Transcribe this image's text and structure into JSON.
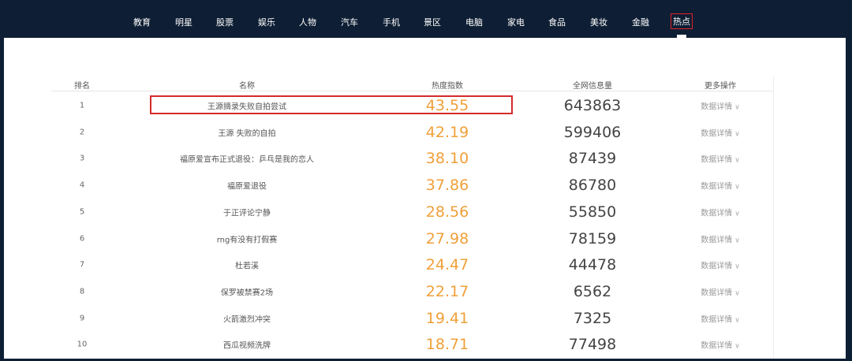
{
  "nav": {
    "items": [
      "教育",
      "明星",
      "股票",
      "娱乐",
      "人物",
      "汽车",
      "手机",
      "景区",
      "电脑",
      "家电",
      "食品",
      "美妆",
      "金融",
      "热点"
    ],
    "active_index": 13
  },
  "table": {
    "headers": {
      "rank": "排名",
      "name": "名称",
      "heat": "热度指数",
      "info": "全网信息量",
      "more": "更多操作"
    },
    "detail_label": "数据详情",
    "rows": [
      {
        "rank": "1",
        "name": "王源摘录失败自拍尝试",
        "heat": "43.55",
        "info": "643863"
      },
      {
        "rank": "2",
        "name": "王源 失败的自拍",
        "heat": "42.19",
        "info": "599406"
      },
      {
        "rank": "3",
        "name": "福原爱宣布正式退役：乒乓是我的恋人",
        "heat": "38.10",
        "info": "87439"
      },
      {
        "rank": "4",
        "name": "福原爱退役",
        "heat": "37.86",
        "info": "86780"
      },
      {
        "rank": "5",
        "name": "于正评论宁静",
        "heat": "28.56",
        "info": "55850"
      },
      {
        "rank": "6",
        "name": "rng有没有打假赛",
        "heat": "27.98",
        "info": "78159"
      },
      {
        "rank": "7",
        "name": "杜若溪",
        "heat": "24.47",
        "info": "44478"
      },
      {
        "rank": "8",
        "name": "保罗被禁赛2场",
        "heat": "22.17",
        "info": "6562"
      },
      {
        "rank": "9",
        "name": "火箭激烈冲突",
        "heat": "19.41",
        "info": "7325"
      },
      {
        "rank": "10",
        "name": "西瓜视频洗牌",
        "heat": "18.71",
        "info": "77498"
      }
    ]
  },
  "colors": {
    "nav_bg": "#0e1e34",
    "heat": "#f0a03a",
    "highlight_border": "#d42a2a"
  }
}
